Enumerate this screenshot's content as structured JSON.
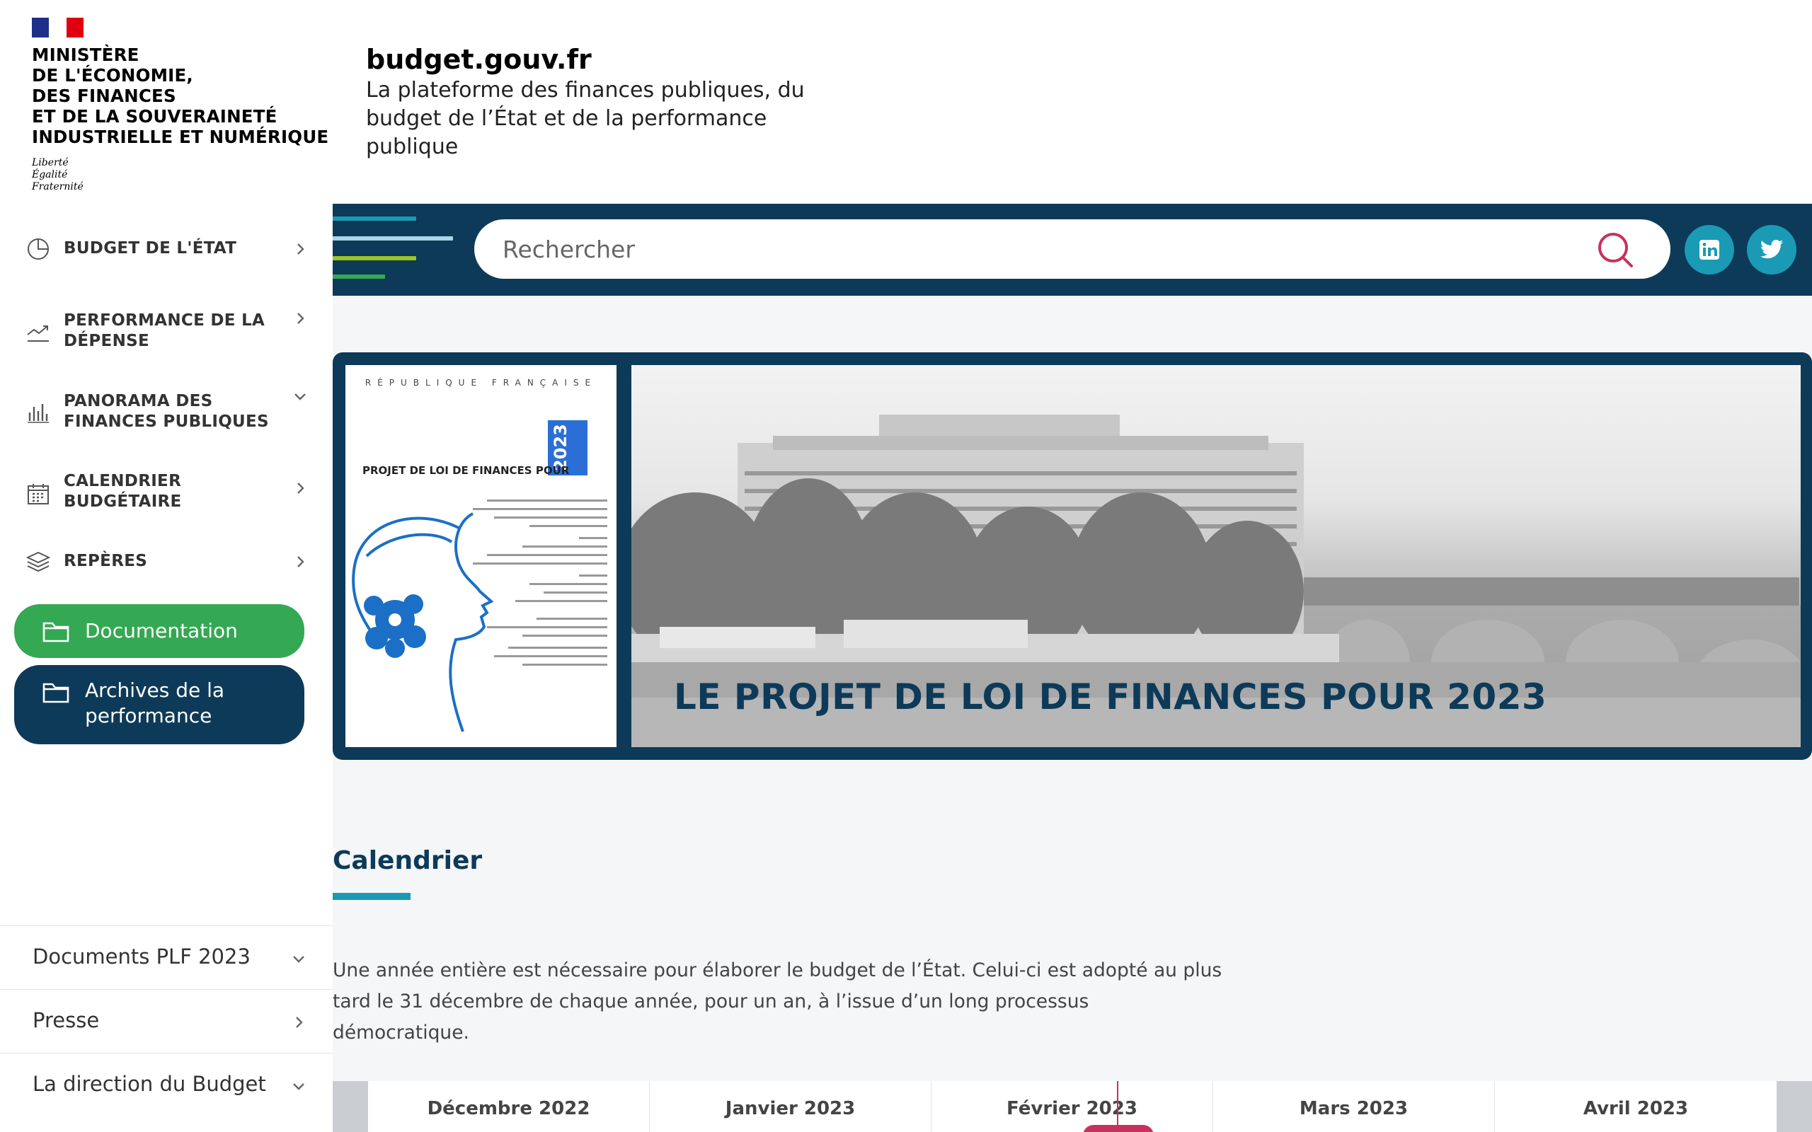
{
  "header": {
    "ministry_lines": [
      "MINISTÈRE",
      "DE L'ÉCONOMIE,",
      "DES FINANCES",
      "ET DE LA SOUVERAINETÉ",
      "INDUSTRIELLE ET NUMÉRIQUE"
    ],
    "motto": [
      "Liberté",
      "Égalité",
      "Fraternité"
    ],
    "site_title": "budget.gouv.fr",
    "site_tagline": "La plateforme des finances publiques, du budget de l’État et de la performance publique"
  },
  "sidebar": {
    "items": [
      {
        "label": "BUDGET DE L'ÉTAT",
        "icon": "pie-chart-icon",
        "chevron": "chevron-right-icon"
      },
      {
        "label": "PERFORMANCE DE LA DÉPENSE",
        "icon": "trend-up-icon",
        "chevron": "chevron-right-icon"
      },
      {
        "label": "PANORAMA DES FINANCES PUBLIQUES",
        "icon": "bar-chart-icon",
        "chevron": "chevron-down-icon"
      },
      {
        "label": "CALENDRIER BUDGÉTAIRE",
        "icon": "calendar-icon",
        "chevron": "chevron-right-icon"
      },
      {
        "label": "REPÈRES",
        "icon": "layers-icon",
        "chevron": "chevron-right-icon"
      }
    ],
    "buttons": [
      {
        "label": "Documentation",
        "icon": "folder-icon",
        "color": "#34a853"
      },
      {
        "label": "Archives de la performance",
        "icon": "folder-icon",
        "color": "#0d3a58"
      }
    ],
    "bottom_items": [
      {
        "label": "Documents PLF 2023",
        "chevron": "chevron-down-icon"
      },
      {
        "label": "Presse",
        "chevron": "chevron-right-icon"
      },
      {
        "label": "La direction du Budget",
        "chevron": "chevron-down-icon"
      }
    ]
  },
  "search": {
    "placeholder": "Rechercher",
    "icon": "search-icon"
  },
  "social": [
    {
      "name": "linkedin-icon",
      "glyph": "in"
    },
    {
      "name": "twitter-icon",
      "glyph": ""
    }
  ],
  "hero": {
    "doc_header": "RÉPUBLIQUE FRANÇAISE",
    "doc_title": "PROJET DE LOI DE FINANCES POUR",
    "doc_year": "2023",
    "title": "LE PROJET DE LOI DE FINANCES POUR 2023"
  },
  "calendar": {
    "title": "Calendrier",
    "text": "Une année entière est nécessaire pour élaborer le budget de l’État. Celui-ci est adopté au plus tard le 31 décembre de chaque année, pour un an, à l’issue d’un long processus démocratique.",
    "months": [
      "Décembre 2022",
      "Janvier 2023",
      "Février 2023",
      "Mars 2023",
      "Avril 2023"
    ]
  },
  "colors": {
    "navy": "#0d3a58",
    "teal": "#1a9ab5",
    "green": "#34a853",
    "accent_pink": "#c8315d"
  }
}
